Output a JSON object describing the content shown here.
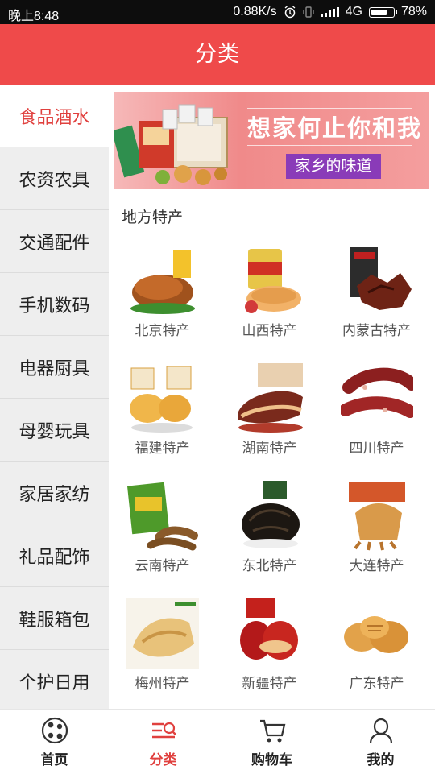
{
  "status_bar": {
    "time": "晚上8:48",
    "speed": "0.88K/s",
    "network": "4G",
    "battery": "78%",
    "icons": [
      "alarm-icon",
      "vibrate-icon",
      "signal-icon",
      "battery-icon"
    ]
  },
  "header": {
    "title": "分类"
  },
  "sidebar": {
    "items": [
      {
        "label": "食品酒水",
        "active": true
      },
      {
        "label": "农资农具"
      },
      {
        "label": "交通配件"
      },
      {
        "label": "手机数码"
      },
      {
        "label": "电器厨具"
      },
      {
        "label": "母婴玩具"
      },
      {
        "label": "家居家纺"
      },
      {
        "label": "礼品配饰"
      },
      {
        "label": "鞋服箱包"
      },
      {
        "label": "个护日用"
      }
    ]
  },
  "banner": {
    "title": "想家何止你和我",
    "subtitle": "家乡的味道"
  },
  "section": {
    "title": "地方特产"
  },
  "products": [
    {
      "label": "北京特产",
      "icon": "roast-duck-image"
    },
    {
      "label": "山西特产",
      "icon": "snack-can-image"
    },
    {
      "label": "内蒙古特产",
      "icon": "dried-beef-image"
    },
    {
      "label": "福建特产",
      "icon": "pastry-image"
    },
    {
      "label": "湖南特产",
      "icon": "cured-meat-image"
    },
    {
      "label": "四川特产",
      "icon": "sausage-image"
    },
    {
      "label": "云南特产",
      "icon": "tamarind-image"
    },
    {
      "label": "东北特产",
      "icon": "black-fungus-image"
    },
    {
      "label": "大连特产",
      "icon": "squid-image"
    },
    {
      "label": "梅州特产",
      "icon": "salt-chicken-image"
    },
    {
      "label": "新疆特产",
      "icon": "red-dates-image"
    },
    {
      "label": "广东特产",
      "icon": "biscuit-image"
    }
  ],
  "tabbar": {
    "items": [
      {
        "label": "首页",
        "icon": "home-icon"
      },
      {
        "label": "分类",
        "icon": "category-icon",
        "active": true
      },
      {
        "label": "购物车",
        "icon": "cart-icon"
      },
      {
        "label": "我的",
        "icon": "user-icon"
      }
    ]
  },
  "colors": {
    "accent": "#ef4a4a",
    "active_text": "#e0403e",
    "banner_tag": "#8a3bb8"
  }
}
